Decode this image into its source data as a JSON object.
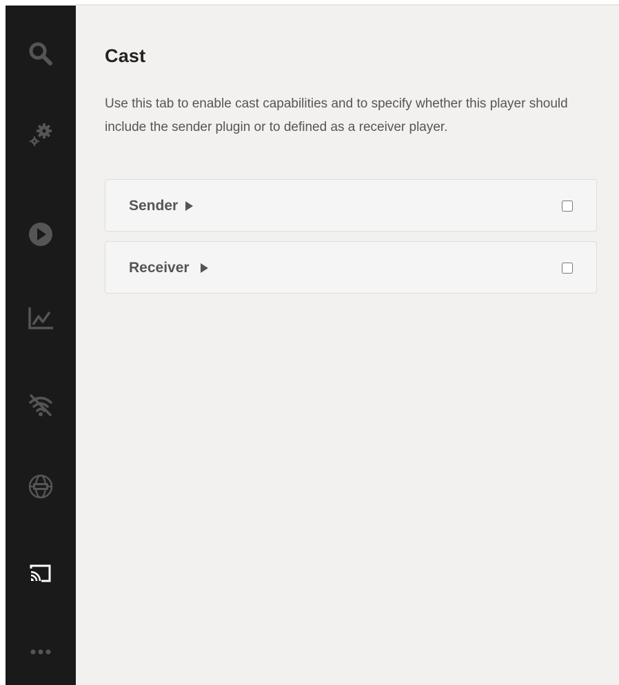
{
  "sidebar": {
    "items": [
      {
        "icon": "search-icon",
        "active": false
      },
      {
        "icon": "gears-icon",
        "active": false
      },
      {
        "icon": "play-circle-icon",
        "active": false
      },
      {
        "icon": "analytics-chart-icon",
        "active": false
      },
      {
        "icon": "offline-wifi-icon",
        "active": false
      },
      {
        "icon": "globe-360-icon",
        "active": false
      },
      {
        "icon": "cast-icon",
        "active": true
      },
      {
        "icon": "more-dots-icon",
        "active": false
      }
    ]
  },
  "main": {
    "title": "Cast",
    "description": "Use this tab to enable cast capabilities and to specify whether this player should include the sender plugin or to defined as a receiver player.",
    "panels": [
      {
        "label": "Sender",
        "checked": false
      },
      {
        "label": "Receiver",
        "checked": false
      }
    ]
  },
  "colors": {
    "sidebar_bg": "#1a1a1a",
    "sidebar_icon": "#555555",
    "sidebar_icon_active": "#ffffff",
    "content_bg": "#f2f1ef",
    "panel_bg": "#f5f5f5",
    "title_text": "#222222",
    "body_text": "#555555"
  }
}
